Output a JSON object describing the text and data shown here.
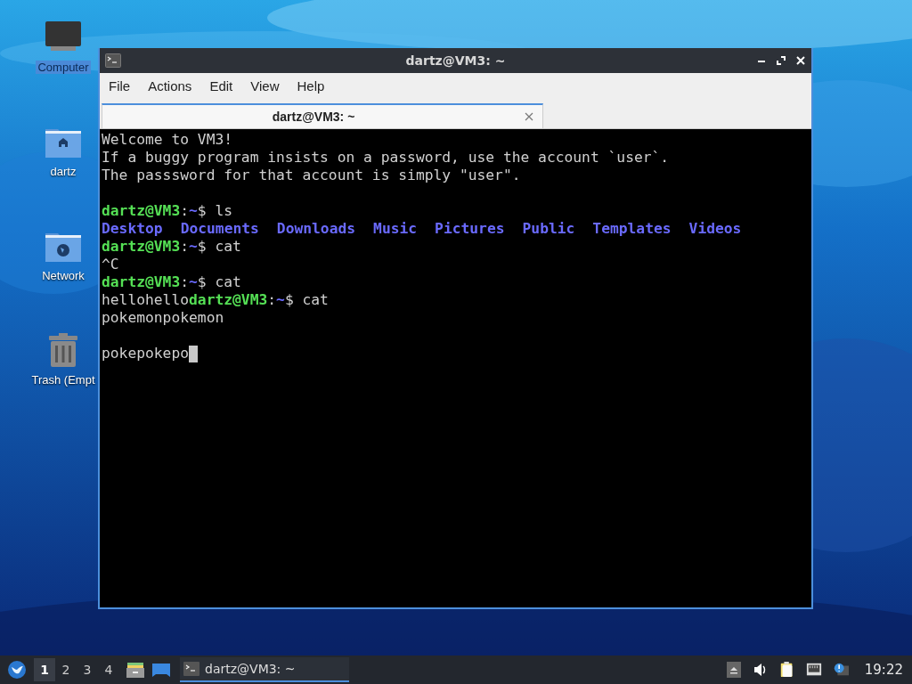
{
  "desktop_icons": [
    {
      "kind": "computer",
      "label": "Computer",
      "selected": true
    },
    {
      "kind": "home",
      "label": "dartz",
      "selected": false
    },
    {
      "kind": "network",
      "label": "Network",
      "selected": false
    },
    {
      "kind": "trash",
      "label": "Trash (Empt",
      "selected": false
    }
  ],
  "window": {
    "title": "dartz@VM3: ~",
    "menu": [
      "File",
      "Actions",
      "Edit",
      "View",
      "Help"
    ],
    "tabs": [
      {
        "label": "dartz@VM3: ~",
        "selected": true
      }
    ],
    "terminal": {
      "cursor": true,
      "lines": [
        {
          "kind": "text",
          "segments": [
            {
              "kind": "plain",
              "text": "Welcome to VM3!"
            }
          ]
        },
        {
          "kind": "text",
          "segments": [
            {
              "kind": "plain",
              "text": "If a buggy program insists on a password, use the account `user`."
            }
          ]
        },
        {
          "kind": "text",
          "segments": [
            {
              "kind": "plain",
              "text": "The passsword for that account is simply \"user\"."
            }
          ]
        },
        {
          "kind": "blank"
        },
        {
          "kind": "text",
          "segments": [
            {
              "kind": "user",
              "text": "dartz@VM3"
            },
            {
              "kind": "plain",
              "text": ":"
            },
            {
              "kind": "path",
              "text": "~"
            },
            {
              "kind": "plain",
              "text": "$ ls"
            }
          ]
        },
        {
          "kind": "listing",
          "items": [
            "Desktop",
            "Documents",
            "Downloads",
            "Music",
            "Pictures",
            "Public",
            "Templates",
            "Videos"
          ]
        },
        {
          "kind": "text",
          "segments": [
            {
              "kind": "user",
              "text": "dartz@VM3"
            },
            {
              "kind": "plain",
              "text": ":"
            },
            {
              "kind": "path",
              "text": "~"
            },
            {
              "kind": "plain",
              "text": "$ cat"
            }
          ]
        },
        {
          "kind": "text",
          "segments": [
            {
              "kind": "plain",
              "text": "^C"
            }
          ]
        },
        {
          "kind": "text",
          "segments": [
            {
              "kind": "user",
              "text": "dartz@VM3"
            },
            {
              "kind": "plain",
              "text": ":"
            },
            {
              "kind": "path",
              "text": "~"
            },
            {
              "kind": "plain",
              "text": "$ cat"
            }
          ]
        },
        {
          "kind": "text",
          "segments": [
            {
              "kind": "plain",
              "text": "hellohello"
            },
            {
              "kind": "user",
              "text": "dartz@VM3"
            },
            {
              "kind": "plain",
              "text": ":"
            },
            {
              "kind": "path",
              "text": "~"
            },
            {
              "kind": "plain",
              "text": "$ cat"
            }
          ]
        },
        {
          "kind": "text",
          "segments": [
            {
              "kind": "plain",
              "text": "pokemonpokemon"
            }
          ]
        },
        {
          "kind": "blank"
        },
        {
          "kind": "text",
          "segments": [
            {
              "kind": "plain",
              "text": "pokepokepo"
            }
          ]
        }
      ]
    }
  },
  "taskbar": {
    "workspaces": [
      {
        "label": "1",
        "selected": true
      },
      {
        "label": "2",
        "selected": false
      },
      {
        "label": "3",
        "selected": false
      },
      {
        "label": "4",
        "selected": false
      }
    ],
    "tasks": [
      {
        "label": "dartz@VM3: ~",
        "selected": true
      }
    ],
    "clock": "19:22"
  }
}
